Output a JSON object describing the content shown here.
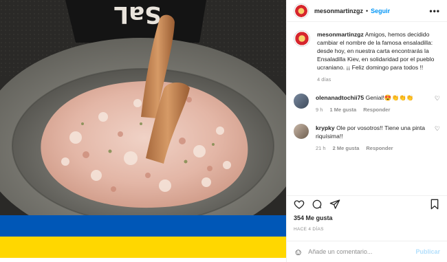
{
  "post": {
    "username": "mesonmartinzgz",
    "follow_label": "Seguir",
    "more_label": "•••",
    "caption_user": "mesonmartinzgz",
    "caption_text": "Amigos, hemos decidido cambiar el nombre de la famosa ensaladilla: desde hoy, en nuestra carta encontrarás la Ensaladilla Kiev, en solidaridad por el pueblo ucraniano. ¡¡ Feliz domingo para todos !!",
    "caption_age": "4 días",
    "comments": [
      {
        "user": "olenanadtochii75",
        "text": "Genial!😍👏👏👏",
        "age": "9 h",
        "likes": "1 Me gusta",
        "reply": "Responder"
      },
      {
        "user": "krypky",
        "text": "Ole por vosotros!! Tiene una pinta riquísima!!",
        "age": "21 h",
        "likes": "2 Me gusta",
        "reply": "Responder"
      }
    ],
    "likes_count": "354 Me gusta",
    "posted_ago": "HACE 4 DÍAS",
    "comment_placeholder": "Añade un comentario...",
    "publish_label": "Publicar"
  },
  "image": {
    "sign_text": "SaL",
    "flag_colors": [
      "#0057b7",
      "#ffd700"
    ]
  }
}
